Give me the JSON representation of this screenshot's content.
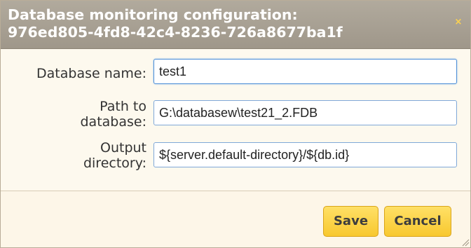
{
  "dialog": {
    "title_line1": "Database monitoring configuration:",
    "title_line2": "976ed805-4fd8-42c4-8236-726a8677ba1f",
    "close_symbol": "×"
  },
  "form": {
    "fields": [
      {
        "label_line1": "Database name:",
        "label_line2": "",
        "value": "test1"
      },
      {
        "label_line1": "Path to",
        "label_line2": "database:",
        "value": "G:\\databasew\\test21_2.FDB"
      },
      {
        "label_line1": "Output",
        "label_line2": "directory:",
        "value": "${server.default-directory}/${db.id}"
      }
    ]
  },
  "buttons": {
    "save_label": "Save",
    "cancel_label": "Cancel"
  },
  "icons": {
    "close": "close-icon",
    "resize": "resize-grip-icon"
  },
  "colors": {
    "button_yellow": "#f8c82f",
    "titlebar": "#a59d90",
    "focus_border": "#4f8fd6"
  }
}
